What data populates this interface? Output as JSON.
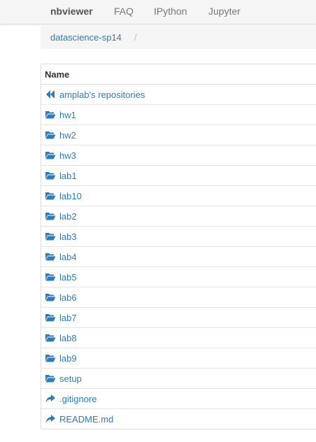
{
  "navbar": {
    "brand": "nbviewer",
    "links": [
      "FAQ",
      "IPython",
      "Jupyter"
    ]
  },
  "breadcrumb": {
    "current": "datascience-sp14",
    "separator": "/"
  },
  "table": {
    "header": "Name",
    "rows": [
      {
        "label": "amplab's repositories",
        "icon": "double-chevron-left-icon"
      },
      {
        "label": "hw1",
        "icon": "folder-open-icon"
      },
      {
        "label": "hw2",
        "icon": "folder-open-icon"
      },
      {
        "label": "hw3",
        "icon": "folder-open-icon"
      },
      {
        "label": "lab1",
        "icon": "folder-open-icon"
      },
      {
        "label": "lab10",
        "icon": "folder-open-icon"
      },
      {
        "label": "lab2",
        "icon": "folder-open-icon"
      },
      {
        "label": "lab3",
        "icon": "folder-open-icon"
      },
      {
        "label": "lab4",
        "icon": "folder-open-icon"
      },
      {
        "label": "lab5",
        "icon": "folder-open-icon"
      },
      {
        "label": "lab6",
        "icon": "folder-open-icon"
      },
      {
        "label": "lab7",
        "icon": "folder-open-icon"
      },
      {
        "label": "lab8",
        "icon": "folder-open-icon"
      },
      {
        "label": "lab9",
        "icon": "folder-open-icon"
      },
      {
        "label": "setup",
        "icon": "folder-open-icon"
      },
      {
        "label": ".gitignore",
        "icon": "share-arrow-icon"
      },
      {
        "label": "README.md",
        "icon": "share-arrow-icon"
      }
    ]
  },
  "colors": {
    "link": "#2f7bb8",
    "navbar_bg": "#f5f5f5",
    "border": "#dddddd"
  }
}
